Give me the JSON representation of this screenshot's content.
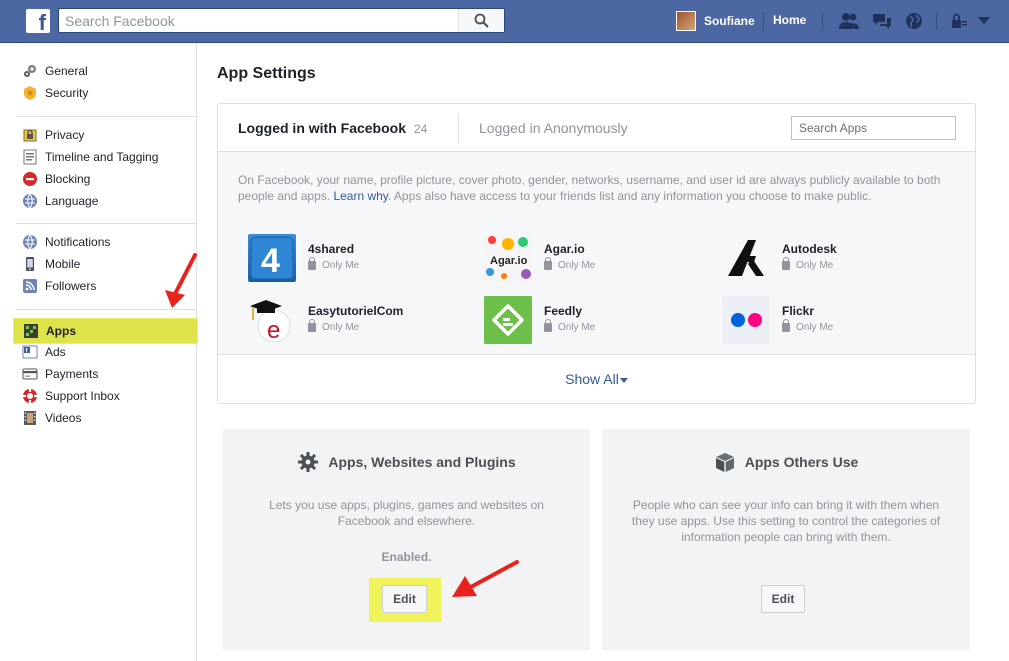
{
  "topbar": {
    "logo_letter": "f",
    "search_placeholder": "Search Facebook",
    "user_name": "Soufiane",
    "home_label": "Home",
    "bg_color": "#4c67a1"
  },
  "sidebar": {
    "groups": [
      [
        {
          "label": "General",
          "icon": "gears-icon"
        },
        {
          "label": "Security",
          "icon": "badge-icon"
        }
      ],
      [
        {
          "label": "Privacy",
          "icon": "privacy-lock-icon"
        },
        {
          "label": "Timeline and Tagging",
          "icon": "timeline-icon"
        },
        {
          "label": "Blocking",
          "icon": "blocking-icon"
        },
        {
          "label": "Language",
          "icon": "globe-icon"
        }
      ],
      [
        {
          "label": "Notifications",
          "icon": "globe-icon"
        },
        {
          "label": "Mobile",
          "icon": "mobile-icon"
        },
        {
          "label": "Followers",
          "icon": "rss-icon"
        }
      ],
      [
        {
          "label": "Apps",
          "icon": "apps-icon",
          "active": true
        },
        {
          "label": "Ads",
          "icon": "ads-icon"
        },
        {
          "label": "Payments",
          "icon": "credit-card-icon"
        },
        {
          "label": "Support Inbox",
          "icon": "lifebuoy-icon"
        },
        {
          "label": "Videos",
          "icon": "film-icon"
        }
      ]
    ]
  },
  "main": {
    "title": "App Settings",
    "tabs": {
      "logged_in": "Logged in with Facebook",
      "count": "24",
      "anonymous": "Logged in Anonymously"
    },
    "search_apps_placeholder": "Search Apps",
    "notice_pre": "On Facebook, your name, profile picture, cover photo, gender, networks, username, and user id are always publicly available to both people and apps.",
    "notice_link": "Learn why",
    "notice_post": ". Apps also have access to your friends list and any information you choose to make public.",
    "apps": [
      {
        "name": "4shared",
        "privacy": "Only Me"
      },
      {
        "name": "Agar.io",
        "privacy": "Only Me"
      },
      {
        "name": "Autodesk",
        "privacy": "Only Me"
      },
      {
        "name": "EasytutorielCom",
        "privacy": "Only Me"
      },
      {
        "name": "Feedly",
        "privacy": "Only Me"
      },
      {
        "name": "Flickr",
        "privacy": "Only Me"
      }
    ],
    "show_all": "Show All"
  },
  "panels": {
    "left": {
      "title": "Apps, Websites and Plugins",
      "desc": "Lets you use apps, plugins, games and websites on Facebook and elsewhere.",
      "status": "Enabled.",
      "button": "Edit"
    },
    "right": {
      "title": "Apps Others Use",
      "desc": "People who can see your info can bring it with them when they use apps. Use this setting to control the categories of information people can bring with them.",
      "button": "Edit"
    }
  },
  "colors": {
    "highlight": "#dfe34a",
    "annotation_arrow": "#e8231c",
    "link": "#365899"
  }
}
